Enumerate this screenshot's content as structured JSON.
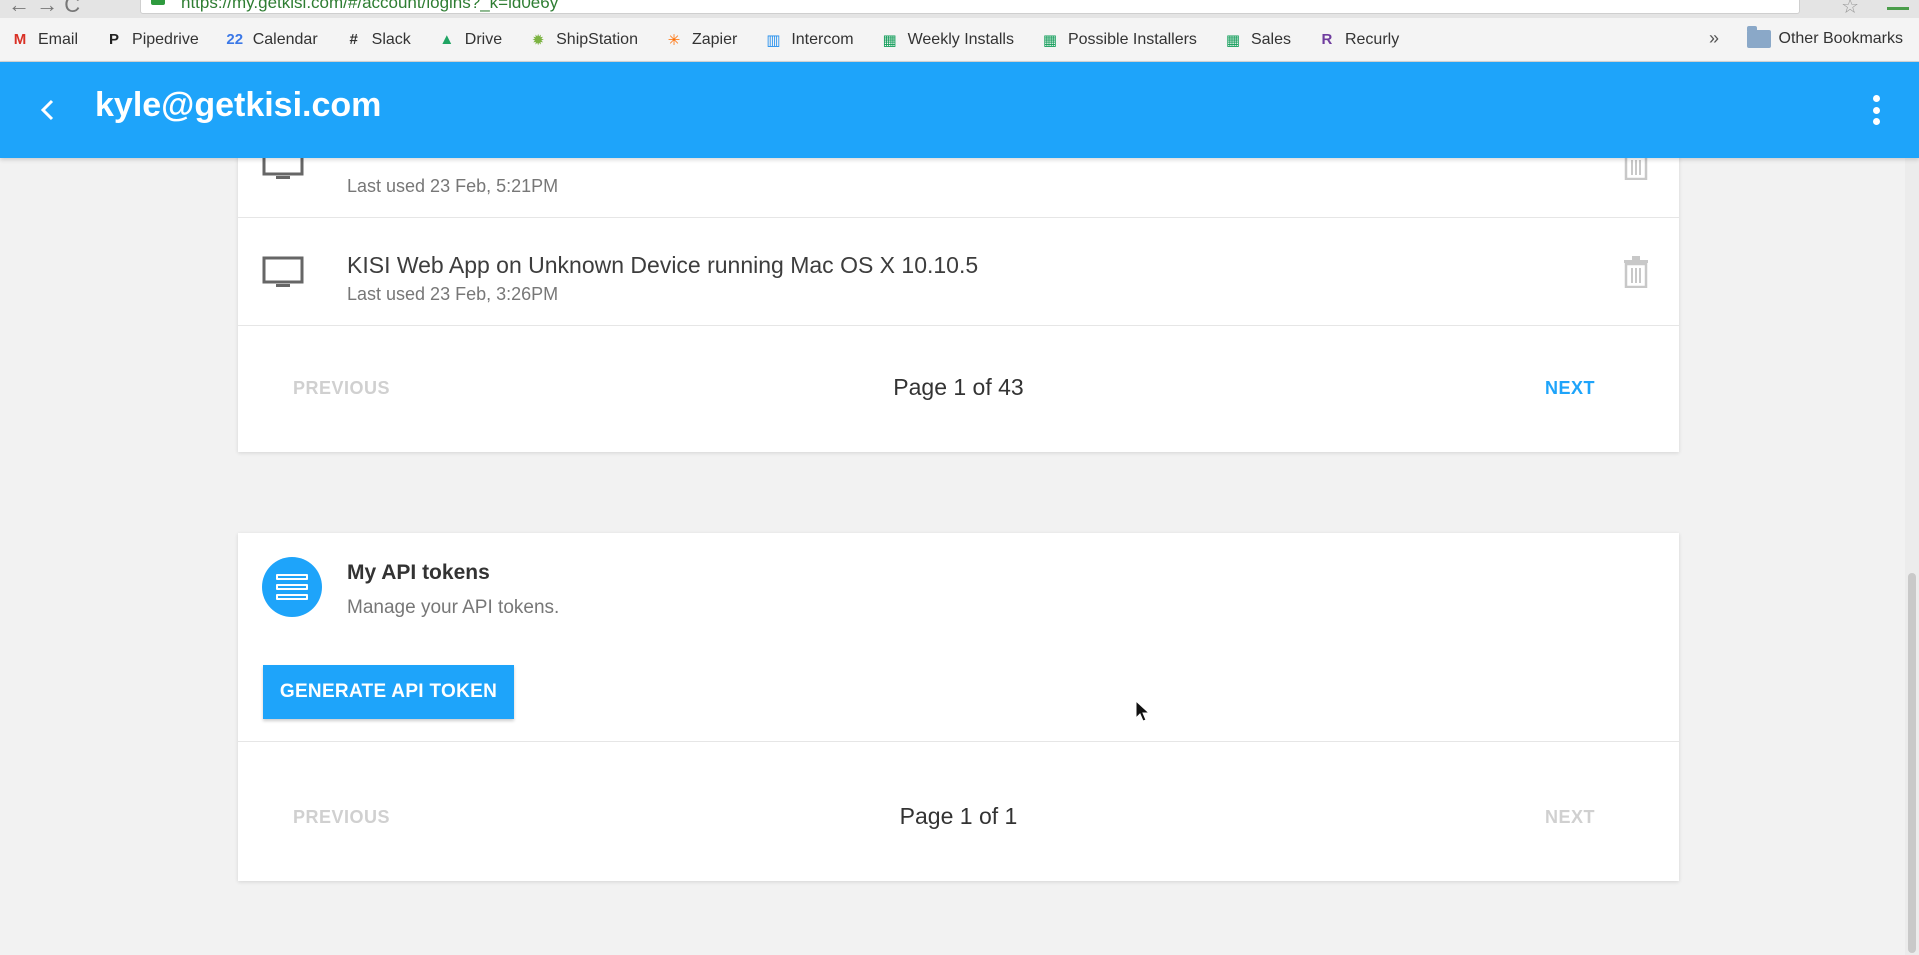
{
  "browser": {
    "url": "https://my.getkisi.com/#/account/logins?_k=ld0e6y",
    "bookmarks": [
      {
        "label": "Email",
        "icon": "gmail-icon",
        "color": "#d93025",
        "glyph": "M"
      },
      {
        "label": "Pipedrive",
        "icon": "pipedrive-icon",
        "color": "#222222",
        "glyph": "P"
      },
      {
        "label": "Calendar",
        "icon": "calendar-icon",
        "color": "#3b78e7",
        "glyph": "22"
      },
      {
        "label": "Slack",
        "icon": "slack-icon",
        "color": "#333333",
        "glyph": "#"
      },
      {
        "label": "Drive",
        "icon": "drive-icon",
        "color": "#1fa463",
        "glyph": "▲"
      },
      {
        "label": "ShipStation",
        "icon": "shipstation-icon",
        "color": "#7cb342",
        "glyph": "✹"
      },
      {
        "label": "Zapier",
        "icon": "zapier-icon",
        "color": "#ff6d00",
        "glyph": "✳"
      },
      {
        "label": "Intercom",
        "icon": "intercom-icon",
        "color": "#1f8ded",
        "glyph": "▥"
      },
      {
        "label": "Weekly Installs",
        "icon": "sheets-icon",
        "color": "#0f9d58",
        "glyph": "▦"
      },
      {
        "label": "Possible Installers",
        "icon": "sheets-icon",
        "color": "#0f9d58",
        "glyph": "▦"
      },
      {
        "label": "Sales",
        "icon": "sheets-icon",
        "color": "#0f9d58",
        "glyph": "▦"
      },
      {
        "label": "Recurly",
        "icon": "recurly-icon",
        "color": "#6f3c9e",
        "glyph": "R"
      }
    ],
    "more": "»",
    "other_bookmarks": "Other Bookmarks"
  },
  "header": {
    "title": "kyle@getkisi.com",
    "accent": "#1ea4fa"
  },
  "logins": {
    "rows": [
      {
        "title": "",
        "last_used": "Last used 23 Feb, 5:21PM"
      },
      {
        "title": "KISI Web App on Unknown Device running Mac OS X 10.10.5",
        "last_used": "Last used 23 Feb, 3:26PM"
      }
    ],
    "pager": {
      "previous": "PREVIOUS",
      "label": "Page 1 of 43",
      "next": "NEXT"
    }
  },
  "api_tokens": {
    "title": "My API tokens",
    "subtitle": "Manage your API tokens.",
    "button": "GENERATE API TOKEN",
    "pager": {
      "previous": "PREVIOUS",
      "label": "Page 1 of 1",
      "next": "NEXT"
    }
  }
}
